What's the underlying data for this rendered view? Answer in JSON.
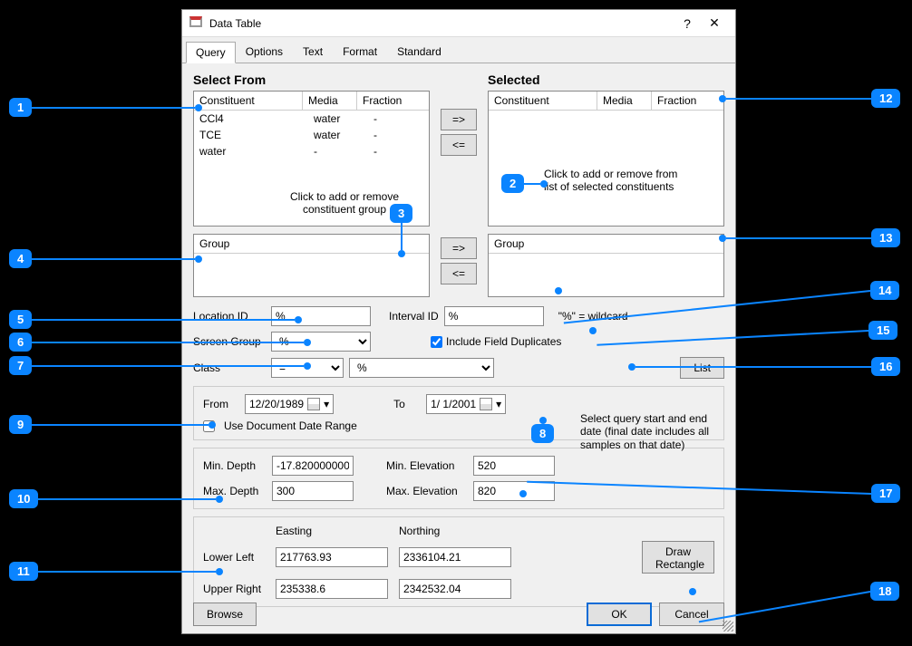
{
  "window": {
    "title": "Data Table"
  },
  "tabs": [
    "Query",
    "Options",
    "Text",
    "Format",
    "Standard"
  ],
  "active_tab": 0,
  "select_from": {
    "label": "Select From",
    "columns": [
      "Constituent",
      "Media",
      "Fraction"
    ],
    "rows": [
      {
        "c": "CCl4",
        "m": "water",
        "f": "-"
      },
      {
        "c": "TCE",
        "m": "water",
        "f": "-"
      },
      {
        "c": "water",
        "m": "-",
        "f": "-"
      }
    ]
  },
  "selected": {
    "label": "Selected",
    "columns": [
      "Constituent",
      "Media",
      "Fraction"
    ],
    "rows": []
  },
  "group_from": {
    "column": "Group"
  },
  "group_selected": {
    "column": "Group"
  },
  "move": {
    "right": "=>",
    "left": "<="
  },
  "filters": {
    "location_id": {
      "label": "Location ID",
      "value": "%"
    },
    "interval_id": {
      "label": "Interval ID",
      "value": "%"
    },
    "wildcard_hint": "\"%\" = wildcard",
    "screen_group": {
      "label": "Screen Group",
      "value": "%"
    },
    "include_dup": {
      "label": "Include Field Duplicates",
      "checked": true
    },
    "class": {
      "label": "Class",
      "op": "=",
      "value": "%"
    },
    "list_btn": "List"
  },
  "dates": {
    "from_label": "From",
    "from": "12/20/1989",
    "to_label": "To",
    "to": "1/ 1/2001",
    "use_doc": "Use Document Date Range"
  },
  "depth": {
    "min_depth": {
      "label": "Min. Depth",
      "value": "-17.820000000"
    },
    "max_depth": {
      "label": "Max. Depth",
      "value": "300"
    },
    "min_elev": {
      "label": "Min. Elevation",
      "value": "520"
    },
    "max_elev": {
      "label": "Max. Elevation",
      "value": "820"
    }
  },
  "coords": {
    "easting": "Easting",
    "northing": "Northing",
    "lower_left": {
      "label": "Lower Left",
      "e": "217763.93",
      "n": "2336104.21"
    },
    "upper_right": {
      "label": "Upper Right",
      "e": "235338.6",
      "n": "2342532.04"
    },
    "draw_btn": "Draw Rectangle"
  },
  "buttons": {
    "browse": "Browse",
    "ok": "OK",
    "cancel": "Cancel"
  },
  "annotations": {
    "a1": "Click to add or remove constituent group",
    "a2": "Click to add or remove from list of selected constituents",
    "a3": "Select query start and end date (final date includes all samples on that date)"
  },
  "callouts": [
    "1",
    "2",
    "3",
    "4",
    "5",
    "6",
    "7",
    "8",
    "9",
    "10",
    "11",
    "12",
    "13",
    "14",
    "15",
    "16",
    "17",
    "18"
  ]
}
